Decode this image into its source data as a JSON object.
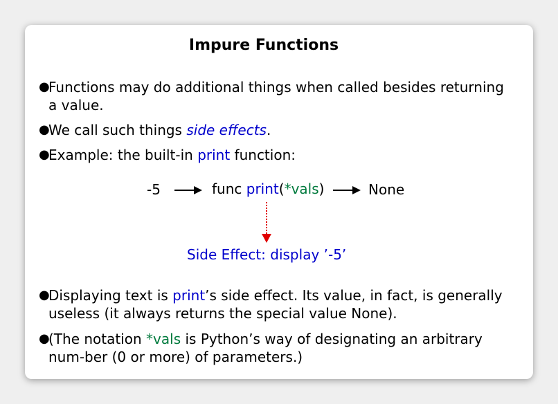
{
  "title": "Impure Functions",
  "bullets": [
    {
      "text": "Functions may do additional things when called besides returning a value."
    },
    {
      "pre": "We call such things ",
      "em": "side effects",
      "post": "."
    },
    {
      "pre": "Example: the built-in ",
      "code": "print",
      "post": " function:"
    },
    {
      "pre": "Displaying text is ",
      "code": "print",
      "post": "’s side effect. Its value, in fact, is generally useless (it always returns the special value None)."
    },
    {
      "pre": "(The notation ",
      "code": "*vals",
      "post": " is Python’s way of designating an arbitrary num-ber (0 or more) of parameters.)"
    }
  ],
  "diagram": {
    "input": "-5",
    "func_word": "func ",
    "func_name": "print",
    "open_paren": "(",
    "param": "*vals",
    "close_paren": ")",
    "output": "None",
    "side_effect": "Side Effect: display ’-5’"
  },
  "colors": {
    "keyword_blue": "#0000cc",
    "param_green": "#007a3d",
    "side_effect_arrow_red": "#e00000"
  }
}
